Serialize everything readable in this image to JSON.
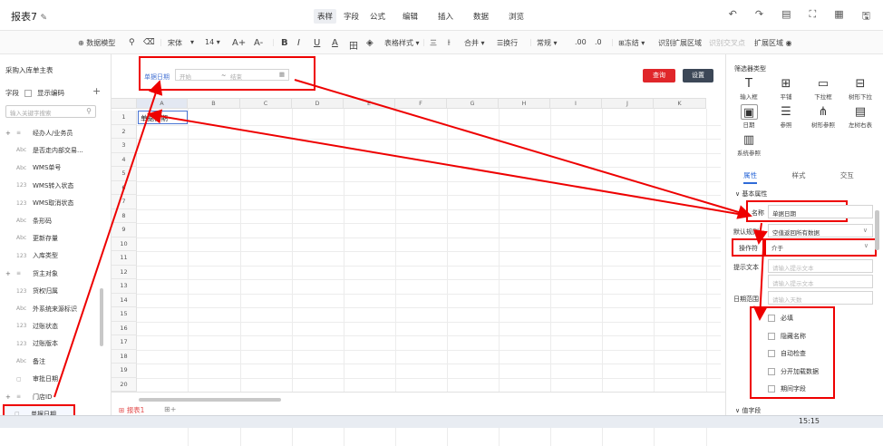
{
  "titlebar": {
    "title": "报表7",
    "edit_icon": "edit-icon",
    "modes": [
      "表样",
      "字段",
      "公式"
    ],
    "menu": [
      "编辑",
      "插入",
      "数据",
      "浏览"
    ],
    "right_icons": [
      "undo-icon",
      "redo-icon",
      "preview-icon",
      "fullscreen-icon",
      "grid-icon",
      "save-icon"
    ]
  },
  "toolbar": {
    "data_model": "数据模型",
    "font": "宋体",
    "font_size": "14",
    "grow": "A+",
    "shrink": "A-",
    "bold": "B",
    "italic": "I",
    "underline": "U",
    "font_color": "A",
    "border": "田",
    "fill": "◈",
    "table_style": "表格样式",
    "align": "三",
    "merge": "合并",
    "wrap": "换行",
    "format": "常规",
    "dec1": ".00",
    "dec2": ".0",
    "freeze": "冻结",
    "identify_area": "识别扩展区域",
    "cross_point": "识别交叉点",
    "expand_area": "扩展区域"
  },
  "left": {
    "header": "采购入库单主表",
    "field_label": "字段",
    "show_code": "显示编码",
    "search_placeholder": "输入关键字搜索",
    "items": [
      {
        "type": "≡",
        "label": "经办人/业务员",
        "expandable": true
      },
      {
        "type": "Abc",
        "label": "是否走内部交易..."
      },
      {
        "type": "Abc",
        "label": "WMS单号"
      },
      {
        "type": "123",
        "label": "WMS转入状态"
      },
      {
        "type": "123",
        "label": "WMS取消状态"
      },
      {
        "type": "Abc",
        "label": "条形码"
      },
      {
        "type": "Abc",
        "label": "更新存量"
      },
      {
        "type": "123",
        "label": "入库类型"
      },
      {
        "type": "≡",
        "label": "货主对象",
        "expandable": true
      },
      {
        "type": "123",
        "label": "货权归属"
      },
      {
        "type": "Abc",
        "label": "外系统来源标识"
      },
      {
        "type": "123",
        "label": "过账状态"
      },
      {
        "type": "123",
        "label": "过账版本"
      },
      {
        "type": "Abc",
        "label": "备注"
      },
      {
        "type": "▢",
        "label": "审批日期"
      },
      {
        "type": "≡",
        "label": "门店ID",
        "expandable": true
      },
      {
        "type": "▢",
        "label": "单据日期",
        "selected": true
      }
    ]
  },
  "filter": {
    "label": "单据日期",
    "start": "开始",
    "sep": "~",
    "end": "结束",
    "query": "查询",
    "settings": "设置"
  },
  "grid": {
    "columns": [
      "A",
      "B",
      "C",
      "D",
      "E",
      "F",
      "G",
      "H",
      "I",
      "J",
      "K"
    ],
    "rows": [
      "1",
      "2",
      "3",
      "4",
      "5",
      "6",
      "7",
      "8",
      "9",
      "10",
      "11",
      "12",
      "13",
      "14",
      "15",
      "16",
      "17",
      "18",
      "19",
      "20"
    ],
    "a1": "单据日期",
    "sheet_tab": "报表1"
  },
  "right": {
    "panel_title": "筛选器类型",
    "types": [
      {
        "icon": "T",
        "label": "输入框"
      },
      {
        "icon": "⊞",
        "label": "平铺"
      },
      {
        "icon": "▭",
        "label": "下拉框"
      },
      {
        "icon": "⊟",
        "label": "树形下拉"
      },
      {
        "icon": "▣",
        "label": "日期",
        "selected": true
      },
      {
        "icon": "☰",
        "label": "参照"
      },
      {
        "icon": "⋔",
        "label": "树形参照"
      },
      {
        "icon": "▤",
        "label": "左树右表"
      },
      {
        "icon": "▥",
        "label": "系统参照"
      }
    ],
    "tabs": [
      "属性",
      "样式",
      "交互"
    ],
    "section_basic": "基本属性",
    "name_label": "名称",
    "name_value": "单据日期",
    "default_label": "默认规则",
    "default_value": "空值返回所有数据",
    "operator_label": "操作符",
    "operator_value": "介于",
    "hint_label": "提示文本",
    "hint_placeholder1": "请输入提示文本",
    "hint_placeholder2": "请输入提示文本",
    "date_range_label": "日期范围",
    "date_range_placeholder": "请输入天数",
    "checks": [
      "必填",
      "隐藏名称",
      "自动检查",
      "分开加载数据",
      "期间字段"
    ],
    "section_value": "值字段"
  },
  "taskbar": {
    "clock": "15:15"
  }
}
